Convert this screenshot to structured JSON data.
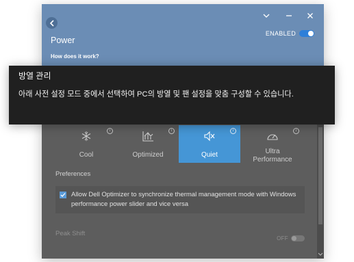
{
  "header": {
    "title": "Power",
    "enabled_label": "ENABLED",
    "how_link": "How does it work?"
  },
  "tooltip": {
    "title": "방열 관리",
    "body": "아래 사전 설정 모드 중에서 선택하여 PC의 방열 및 팬 설정을 맞춤 구성할 수 있습니다."
  },
  "modes": [
    {
      "label": "Cool",
      "icon": "snowflake-icon"
    },
    {
      "label": "Optimized",
      "icon": "chart-icon"
    },
    {
      "label": "Quiet",
      "icon": "speaker-mute-icon",
      "selected": true
    },
    {
      "label_line1": "Ultra",
      "label_line2": "Performance",
      "icon": "speedometer-icon"
    }
  ],
  "preferences": {
    "title": "Preferences",
    "checkbox_label": "Allow Dell Optimizer to synchronize thermal management mode with Windows performance power slider and vice versa",
    "checked": true
  },
  "peak_shift": {
    "title": "Peak Shift",
    "toggle_label": "OFF"
  },
  "colors": {
    "header": "#6b8db5",
    "accent": "#4596d6",
    "panel": "#5d5d5d",
    "tooltip": "#202020"
  }
}
